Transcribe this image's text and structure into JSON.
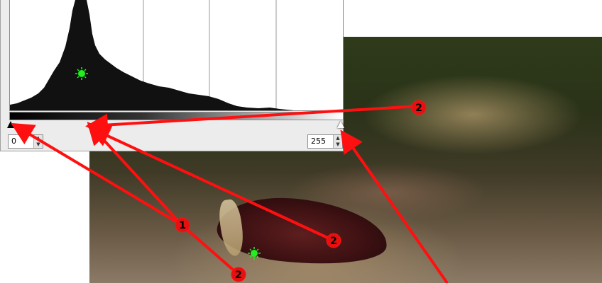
{
  "levels_dialog": {
    "input_black_value": "0",
    "input_white_value": "255"
  },
  "colors": {
    "arrow": "#ff1010",
    "badge_fill": "#e61010",
    "marker": "#22ee22",
    "histogram_fill": "#111111"
  },
  "annotations": {
    "badge_1": "1",
    "badge_2": "2"
  },
  "icons": {
    "marker": "color-picker-marker-icon",
    "badge": "numbered-circle-icon"
  }
}
